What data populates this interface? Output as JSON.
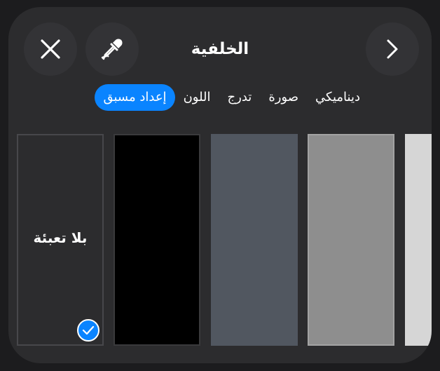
{
  "header": {
    "title": "الخلفية"
  },
  "icons": {
    "close": "close-icon",
    "eyedropper": "eyedropper-icon",
    "next": "chevron-right-icon",
    "check": "checkmark-icon"
  },
  "tabs": [
    {
      "label": "إعداد مسبق",
      "active": true
    },
    {
      "label": "اللون",
      "active": false
    },
    {
      "label": "تدرج",
      "active": false
    },
    {
      "label": "صورة",
      "active": false
    },
    {
      "label": "ديناميكي",
      "active": false
    }
  ],
  "swatches": {
    "no_fill_label": "بلا تعبئة",
    "colors": [
      "#000000",
      "#515760",
      "#8e8e8e",
      "#d6d6d6"
    ]
  },
  "colors": {
    "accent": "#0a84ff",
    "panel": "#2c2c2e"
  }
}
